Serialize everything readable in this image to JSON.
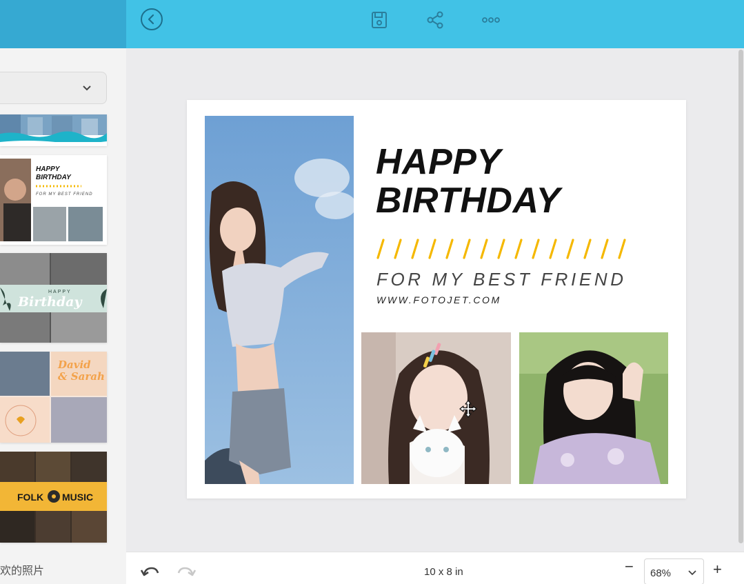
{
  "card": {
    "title_line1": "HAPPY",
    "title_line2": "BIRTHDAY",
    "subtitle": "FOR MY BEST FRIEND",
    "website": "WWW.FOTOJET.COM"
  },
  "templates": [
    {
      "name": "template-blue-group"
    },
    {
      "name": "template-happy-birthday",
      "line1": "HAPPY",
      "line2": "BIRTHDAY",
      "line3": "FOR MY BEST FRIEND"
    },
    {
      "name": "template-birthday-floral",
      "small": "HAPPY",
      "big": "Birthday"
    },
    {
      "name": "template-david-sarah",
      "line1": "David",
      "line2": "& Sarah"
    },
    {
      "name": "template-folk-music",
      "left": "FOLK",
      "right": "MUSIC"
    }
  ],
  "sidebar": {
    "caption": "欢的照片"
  },
  "bottom": {
    "size": "10 x 8 in",
    "zoom": "68%",
    "zoom_minus": "−",
    "zoom_plus": "+"
  },
  "colors": {
    "topbar": "#41c2e6",
    "accent_yellow": "#f5b800"
  }
}
